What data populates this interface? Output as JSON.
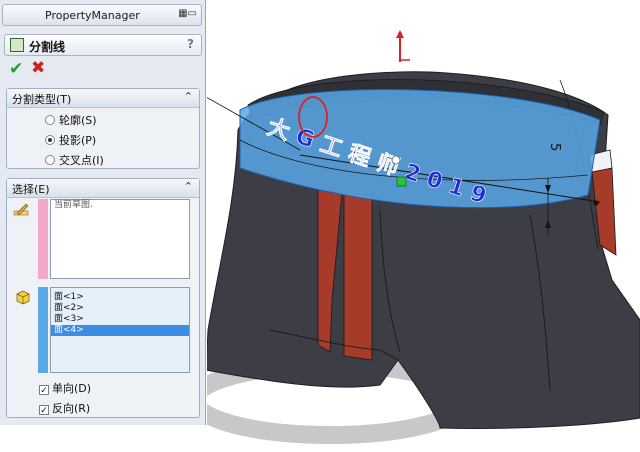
{
  "property_manager": {
    "title": "PropertyManager",
    "feature_name": "分割线",
    "help": "?",
    "ok_symbol": "✔",
    "cancel_symbol": "✖",
    "split_type": {
      "header": "分割类型(T)",
      "options": [
        {
          "label": "轮廓(S)",
          "selected": false
        },
        {
          "label": "投影(P)",
          "selected": true
        },
        {
          "label": "交叉点(I)",
          "selected": false
        }
      ]
    },
    "selection": {
      "header": "选择(E)",
      "sketch_list": [
        "当前草图."
      ],
      "face_list": [
        "面<1>",
        "面<2>",
        "面<3>",
        "面<4>"
      ],
      "selected_face": "面<4>",
      "checkboxes": [
        {
          "label": "单向(D)",
          "checked": true
        },
        {
          "label": "反向(R)",
          "checked": true
        }
      ]
    }
  },
  "viewport": {
    "sketch_text": "大 G 工 程 师 2 0 1 9",
    "dimension": "5"
  },
  "colors": {
    "panel_bg": "#e4e9f2",
    "sketch_strip": "#f2a9c9",
    "face_strip": "#5aa9e6",
    "highlight": "#3c8de3",
    "model_body": "#3d3e45",
    "model_stripe": "#a73b2a",
    "selected_band": "#58a7e6",
    "sketch_text_color": "#1f2bd9",
    "circle_mark": "#e02020"
  }
}
